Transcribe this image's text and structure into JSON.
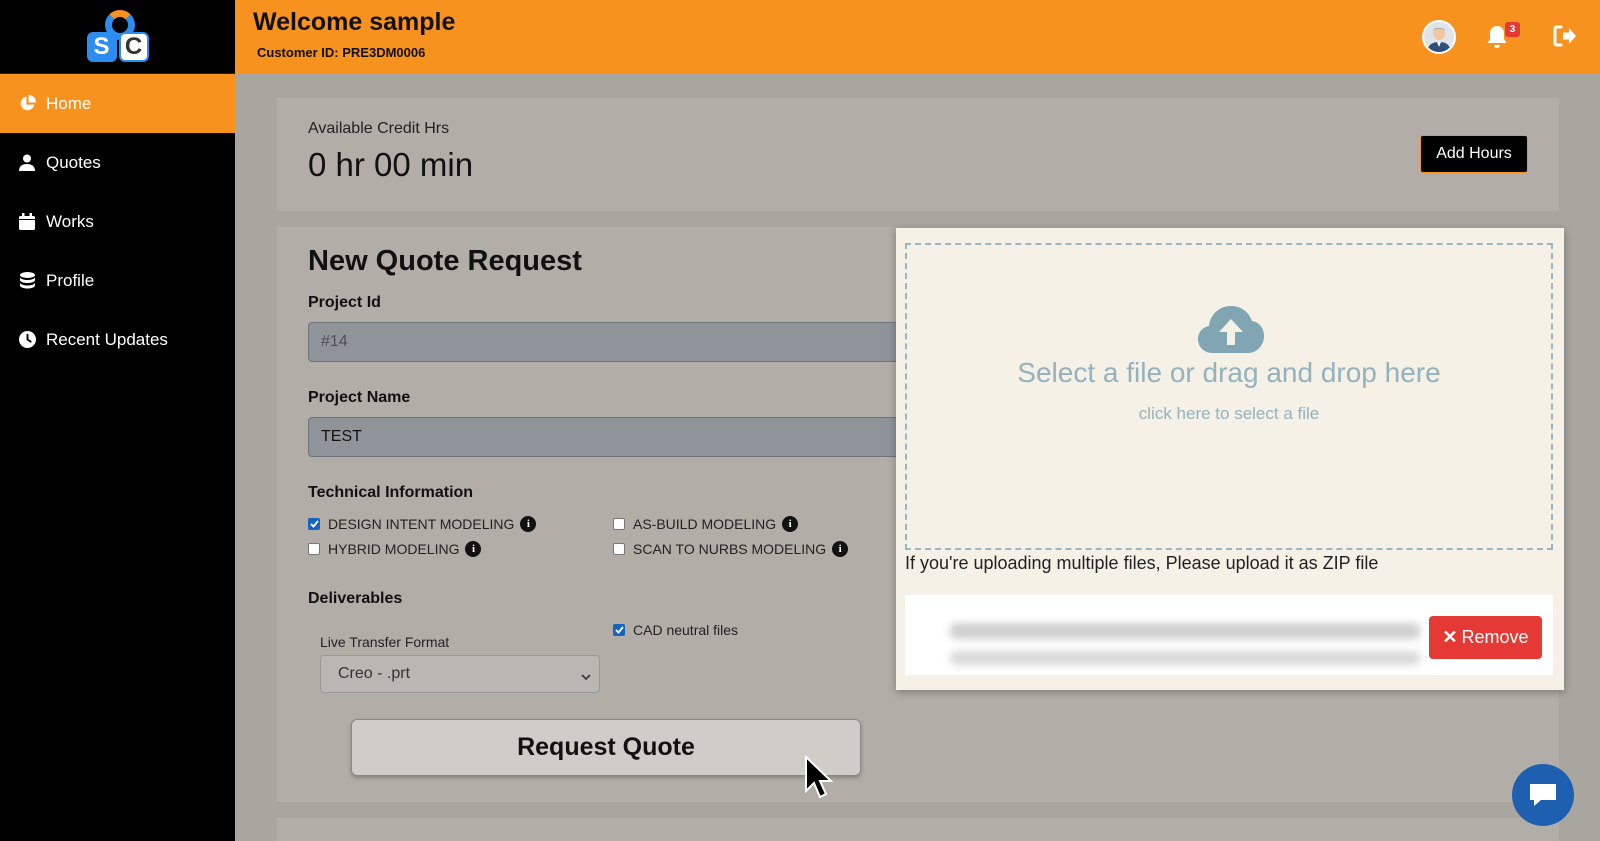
{
  "header": {
    "welcome": "Welcome sample",
    "customer_id": "Customer ID: PRE3DM0006",
    "notification_count": "3"
  },
  "sidebar": {
    "items": [
      {
        "label": "Home",
        "icon": "pie-chart-icon",
        "active": true
      },
      {
        "label": "Quotes",
        "icon": "user-icon",
        "active": false
      },
      {
        "label": "Works",
        "icon": "calendar-icon",
        "active": false
      },
      {
        "label": "Profile",
        "icon": "database-icon",
        "active": false
      },
      {
        "label": "Recent Updates",
        "icon": "clock-icon",
        "active": false
      }
    ]
  },
  "credit": {
    "label": "Available Credit Hrs",
    "value": "0 hr 00 min",
    "add_hours": "Add Hours"
  },
  "quote": {
    "title": "New Quote Request",
    "project_id_label": "Project Id",
    "project_id_placeholder": "#14",
    "project_name_label": "Project Name",
    "project_name_value": "TEST",
    "technical_label": "Technical Information",
    "options": [
      {
        "label": "DESIGN INTENT MODELING",
        "checked": true
      },
      {
        "label": "AS-BUILD MODELING",
        "checked": false
      },
      {
        "label": "HYBRID MODELING",
        "checked": false
      },
      {
        "label": "SCAN TO NURBS MODELING",
        "checked": false
      }
    ],
    "deliverables_label": "Deliverables",
    "live_transfer_label": "Live Transfer Format",
    "live_transfer_value": "Creo - .prt",
    "cad_neutral_label": "CAD neutral files",
    "cad_neutral_checked": true,
    "request_button": "Request Quote"
  },
  "upload": {
    "title": "Select a file or drag and drop here",
    "subtitle": "click here to select a file",
    "zip_note": "If you're uploading multiple files, Please upload it as ZIP file",
    "remove_label": "Remove"
  },
  "colors": {
    "accent": "#f7921e",
    "sidebar": "#000000",
    "remove": "#e53935",
    "chat": "#1e5fb0"
  }
}
